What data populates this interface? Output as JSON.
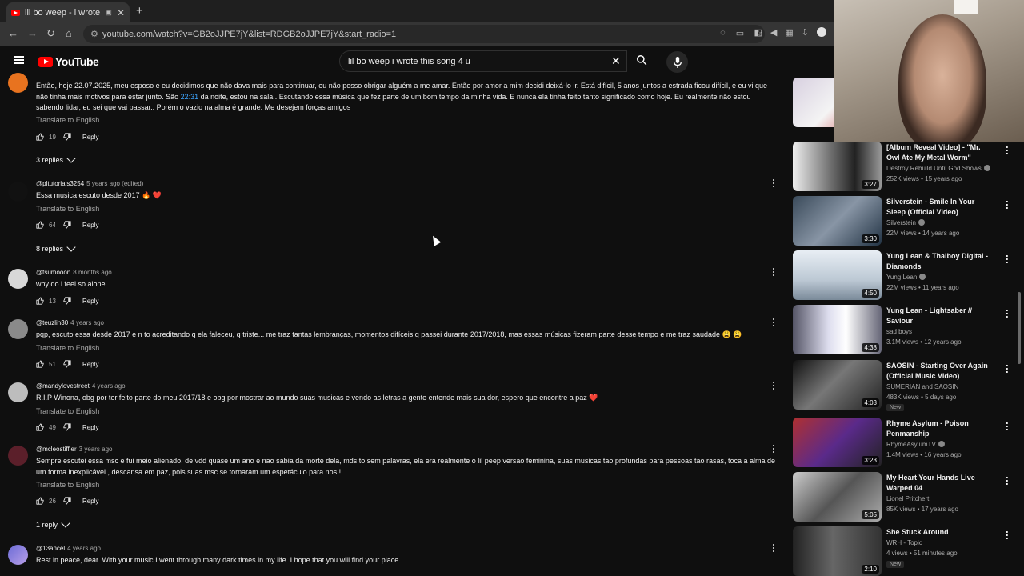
{
  "browser": {
    "tab_title": "lil bo weep - i wrote this song",
    "new_tab": "+",
    "url": "youtube.com/watch?v=GB2oJJPE7jY&list=RDGB2oJJPE7jY&start_radio=1"
  },
  "header": {
    "logo_text": "YouTube",
    "search_value": "lil bo weep i wrote this song 4 u"
  },
  "comments": [
    {
      "author": "",
      "time": "",
      "text": "Então, hoje 22.07.2025, meu esposo e eu decidimos que não dava mais para continuar, eu não posso obrigar alguém a me amar. Então por amor a mim decidi deixá-lo ir. Está difícil, 5 anos juntos a estrada ficou difícil, e eu vi que não tinha mais motivos para estar junto. São ",
      "timestamp_link": "22:31",
      "text_after": " da noite, estou na sala.. Escutando essa música que fez parte de um bom tempo da minha vida. E nunca ela tinha feito tanto significado como hoje. Eu realmente não estou sabendo lidar, eu sei que vai passar.. Porém o vazio na alma é grande. Me desejem forças amigos",
      "translate": "Translate to English",
      "likes": "19",
      "reply": "Reply",
      "replies": "3 replies"
    },
    {
      "author": "@pltutoriais3254",
      "time": "5 years ago (edited)",
      "text": "Essa musica escuto desde 2017 🔥 ❤️",
      "translate": "Translate to English",
      "likes": "64",
      "reply": "Reply",
      "replies": "8 replies"
    },
    {
      "author": "@tsumooon",
      "time": "8 months ago",
      "text": "why do i feel so alone",
      "likes": "13",
      "reply": "Reply"
    },
    {
      "author": "@teuzlin30",
      "time": "4 years ago",
      "text": "pqp, escuto essa desde 2017 e n to acreditando q ela faleceu, q triste... me traz tantas lembranças, momentos difíceis q passei durante 2017/2018, mas essas músicas fizeram parte desse tempo e me traz saudade 😩 😩",
      "translate": "Translate to English",
      "likes": "51",
      "reply": "Reply"
    },
    {
      "author": "@mandylovestreet",
      "time": "4 years ago",
      "text": "R.I.P Winona, obg por ter feito parte do meu 2017/18 e obg por mostrar ao mundo suas musicas e vendo as letras a gente entende mais sua dor, espero que encontre a paz ❤️",
      "translate": "Translate to English",
      "likes": "49",
      "reply": "Reply"
    },
    {
      "author": "@mcleostiffler",
      "time": "3 years ago",
      "text": "Sempre escutei essa msc e fui meio alienado, de vdd quase um ano e nao sabia da morte dela, mds to sem palavras, ela era realmente o lil peep versao feminina, suas musicas tao profundas para pessoas tao rasas, toca a alma de um forma inexplicável , descansa em paz, pois suas msc se tornaram um espetáculo para nos !",
      "translate": "Translate to English",
      "likes": "26",
      "reply": "Reply",
      "replies": "1 reply"
    },
    {
      "author": "@13ancel",
      "time": "4 years ago",
      "text": "Rest in peace, dear. With your music I went through many dark times in my life. I hope that you will find your place"
    }
  ],
  "sidebar": {
    "videos": [
      {
        "title": "",
        "channel": "",
        "meta": "",
        "duration": ""
      },
      {
        "title": "[Album Reveal Video] - \"Mr. Owl Ate My Metal Worm\"",
        "channel": "Destroy Rebuild Until God Shows",
        "meta": "252K views • 15 years ago",
        "duration": "3:27"
      },
      {
        "title": "Silverstein - Smile In Your Sleep (Official Video)",
        "channel": "Silverstein",
        "meta": "22M views • 14 years ago",
        "duration": "3:30"
      },
      {
        "title": "Yung Lean & Thaiboy Digital - Diamonds",
        "channel": "Yung Lean",
        "meta": "22M views • 11 years ago",
        "duration": "4:50"
      },
      {
        "title": "Yung Lean - Lightsaber // Saviour",
        "channel": "sad boys",
        "meta": "3.1M views • 12 years ago",
        "duration": "4:38"
      },
      {
        "title": "SAOSIN - Starting Over Again (Official Music Video)",
        "channel": "SUMERIAN and SAOSIN",
        "meta": "483K views • 5 days ago",
        "duration": "4:03",
        "badge": "New"
      },
      {
        "title": "Rhyme Asylum - Poison Penmanship",
        "channel": "RhymeAsylumTV",
        "meta": "1.4M views • 16 years ago",
        "duration": "3:23"
      },
      {
        "title": "My Heart Your Hands Live Warped 04",
        "channel": "Lionel Pritchert",
        "meta": "85K views • 17 years ago",
        "duration": "5:05"
      },
      {
        "title": "She Stuck Around",
        "channel": "WRH - Topic",
        "meta": "4 views • 51 minutes ago",
        "duration": "2:10",
        "badge": "New"
      }
    ]
  },
  "colors": {
    "background": "#0f0f0f",
    "link": "#3ea6ff",
    "brand_red": "#ff0000"
  }
}
